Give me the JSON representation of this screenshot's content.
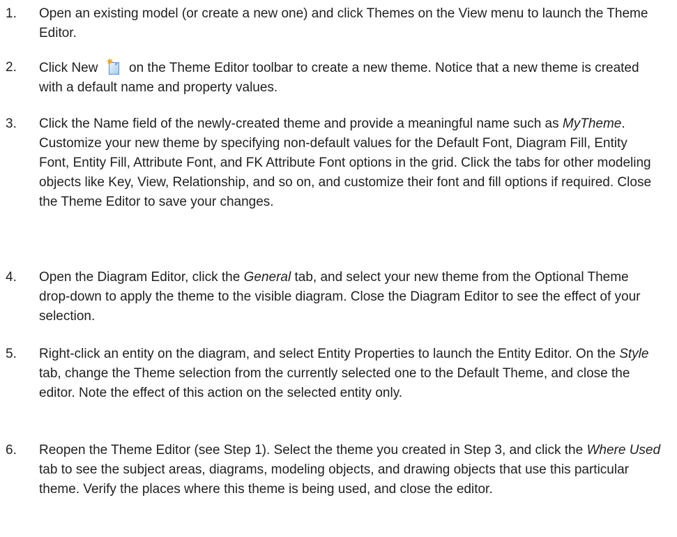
{
  "steps": [
    {
      "number": "1.",
      "parts": [
        "Open an existing model (or create a new one) and click Themes on the View menu to launch the Theme Editor."
      ]
    },
    {
      "number": "2.",
      "parts": [
        "Click New ",
        " on the Theme Editor toolbar to create a new theme. Notice that a new theme is created with a default name and property values."
      ],
      "icon": "new-theme-icon"
    },
    {
      "number": "3.",
      "parts": [
        "Click the Name field of the newly-created theme and provide a meaningful name such as ",
        "MyTheme",
        ". Customize your new theme by specifying non-default values for the Default Font, Diagram Fill, Entity Font, Entity Fill, Attribute Font, and FK Attribute Font options in the grid. Click the tabs for other modeling objects like Key, View, Relationship, and so on, and customize their font and fill options if required. Close the Theme Editor to save your changes."
      ]
    },
    {
      "number": "4.",
      "parts": [
        "Open the Diagram Editor, click the ",
        "General",
        " tab, and select your new theme from the Optional Theme drop-down to apply the theme to the visible diagram. Close the Diagram Editor to see the effect of your selection."
      ]
    },
    {
      "number": "5.",
      "parts": [
        "Right-click an entity on the diagram, and select Entity Properties to launch the Entity Editor. On the ",
        "Style",
        " tab, change the Theme selection from the currently selected one to the Default Theme, and close the editor. Note the effect of this action on the selected entity only."
      ]
    },
    {
      "number": "6.",
      "parts": [
        "Reopen the Theme Editor (see Step 1). Select the theme you created in Step 3, and click the ",
        "Where Used",
        " tab to see the subject areas, diagrams, modeling objects, and drawing objects that use this particular theme. Verify the places where this theme is being used, and close the editor."
      ]
    }
  ]
}
